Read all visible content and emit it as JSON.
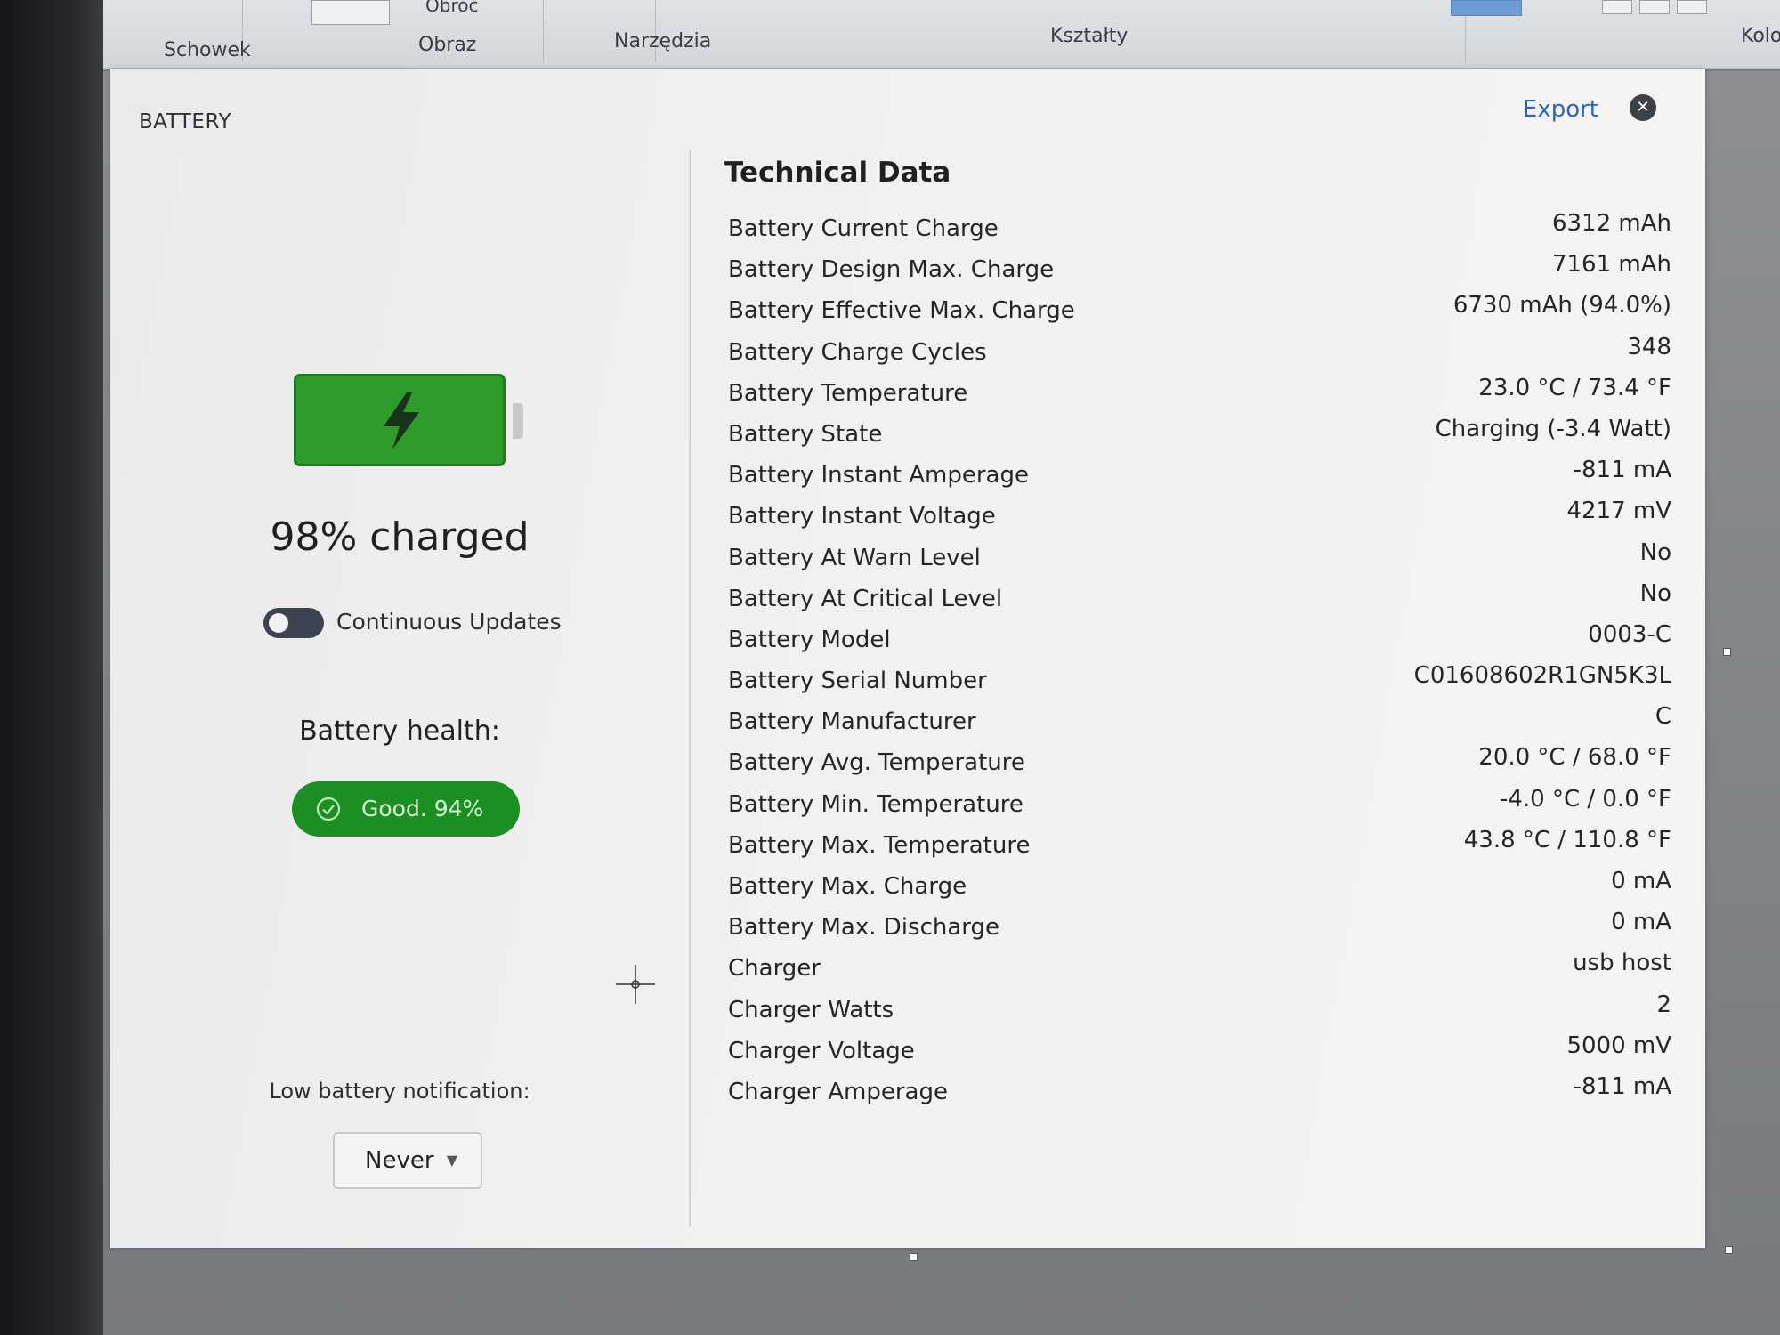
{
  "ribbon": {
    "groups": [
      "Schowek",
      "Obraz",
      "Narzędzia",
      "Kształty",
      "Kolo"
    ],
    "rotate_label": "Obróć"
  },
  "dialog": {
    "title": "BATTERY",
    "export_label": "Export",
    "close_glyph": "✕"
  },
  "battery": {
    "charge_text": "98% charged",
    "fill_percent": 98,
    "accent_color": "#2e9b2b",
    "continuous_updates_label": "Continuous Updates",
    "continuous_updates_on": false,
    "health_label": "Battery health:",
    "health_badge": "Good. 94%",
    "low_notification_label": "Low battery notification:",
    "low_notification_value": "Never"
  },
  "technical": {
    "title": "Technical Data",
    "rows": [
      {
        "label": "Battery Current Charge",
        "value": "6312 mAh"
      },
      {
        "label": "Battery Design Max. Charge",
        "value": "7161 mAh"
      },
      {
        "label": "Battery Effective Max. Charge",
        "value": "6730 mAh (94.0%)"
      },
      {
        "label": "Battery Charge Cycles",
        "value": "348"
      },
      {
        "label": "Battery Temperature",
        "value": "23.0 °C / 73.4 °F"
      },
      {
        "label": "Battery State",
        "value": "Charging (-3.4 Watt)"
      },
      {
        "label": "Battery Instant Amperage",
        "value": "-811 mA"
      },
      {
        "label": "Battery Instant Voltage",
        "value": "4217 mV"
      },
      {
        "label": "Battery At Warn Level",
        "value": "No"
      },
      {
        "label": "Battery At Critical Level",
        "value": "No"
      },
      {
        "label": "Battery Model",
        "value": "0003-C"
      },
      {
        "label": "Battery Serial Number",
        "value": "C01608602R1GN5K3L"
      },
      {
        "label": "Battery Manufacturer",
        "value": "C"
      },
      {
        "label": "Battery Avg. Temperature",
        "value": "20.0 °C / 68.0 °F"
      },
      {
        "label": "Battery Min. Temperature",
        "value": "-4.0 °C / 0.0 °F"
      },
      {
        "label": "Battery Max. Temperature",
        "value": "43.8 °C / 110.8 °F"
      },
      {
        "label": "Battery Max. Charge",
        "value": "0 mA"
      },
      {
        "label": "Battery Max. Discharge",
        "value": "0 mA"
      },
      {
        "label": "Charger",
        "value": "usb host"
      },
      {
        "label": "Charger Watts",
        "value": "2"
      },
      {
        "label": "Charger Voltage",
        "value": "5000 mV"
      },
      {
        "label": "Charger Amperage",
        "value": "-811 mA"
      }
    ]
  },
  "icons": {
    "bolt": "lightning-bolt-icon",
    "check": "check-circle-icon",
    "close": "close-icon",
    "chevron": "chevron-down-icon",
    "crosshair": "crosshair-cursor-icon"
  }
}
